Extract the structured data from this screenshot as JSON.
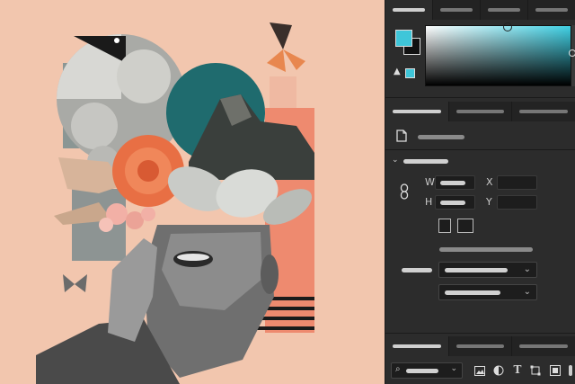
{
  "colors": {
    "canvas_bg": "#f2c6ae",
    "panel_bg": "#2c2c2c",
    "tab_bg": "#232323",
    "foreground_swatch": "#3fc6d9",
    "background_swatch": "#111111",
    "picker_hue": "#3fd0e4"
  },
  "panel": {
    "properties_labels": {
      "w": "W",
      "h": "H",
      "x": "X",
      "y": "Y"
    }
  },
  "icons": {
    "document": "document-icon",
    "link": "link-icon",
    "warning": "warning-icon",
    "search": "search-icon",
    "image": "image-icon",
    "adjust": "adjustment-icon",
    "text": "text-tool-icon",
    "transform": "transform-icon",
    "shape": "shape-icon",
    "more": "chevron-down-icon"
  }
}
